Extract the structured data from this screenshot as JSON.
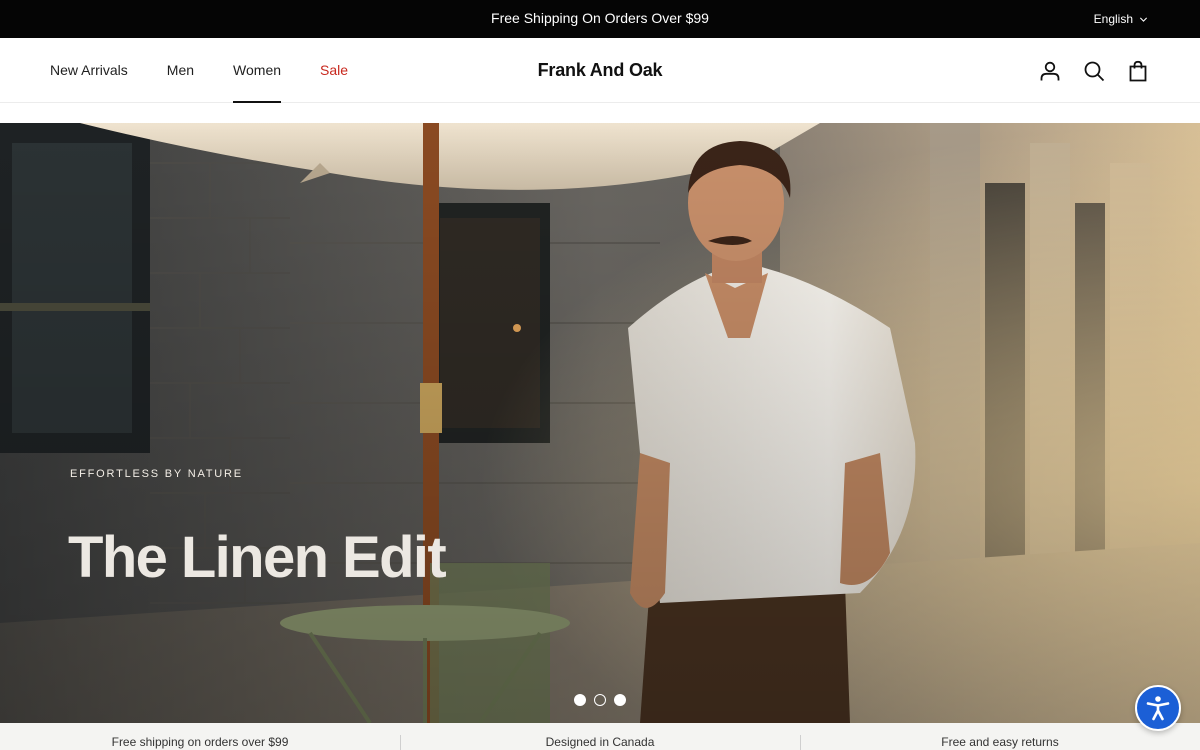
{
  "announcement": {
    "text": "Free Shipping On Orders Over $99",
    "language": "English",
    "language_icon": "chevron-down-icon"
  },
  "header": {
    "nav": [
      {
        "label": "New Arrivals"
      },
      {
        "label": "Men"
      },
      {
        "label": "Women",
        "active": true
      },
      {
        "label": "Sale",
        "color": "#c8281e"
      }
    ],
    "logo": "Frank And Oak",
    "icons": [
      "account-icon",
      "search-icon",
      "shopping-bag-icon"
    ]
  },
  "hero": {
    "eyebrow": "EFFORTLESS BY NATURE",
    "title": "The Linen Edit",
    "slides": {
      "count": 3,
      "active": 1
    }
  },
  "value_props": [
    {
      "text": "Free shipping on orders over $99"
    },
    {
      "text": "Designed in Canada"
    },
    {
      "text": "Free and easy returns"
    }
  ],
  "accessibility": {
    "icon": "accessibility-icon",
    "color": "#1b5fd6"
  }
}
